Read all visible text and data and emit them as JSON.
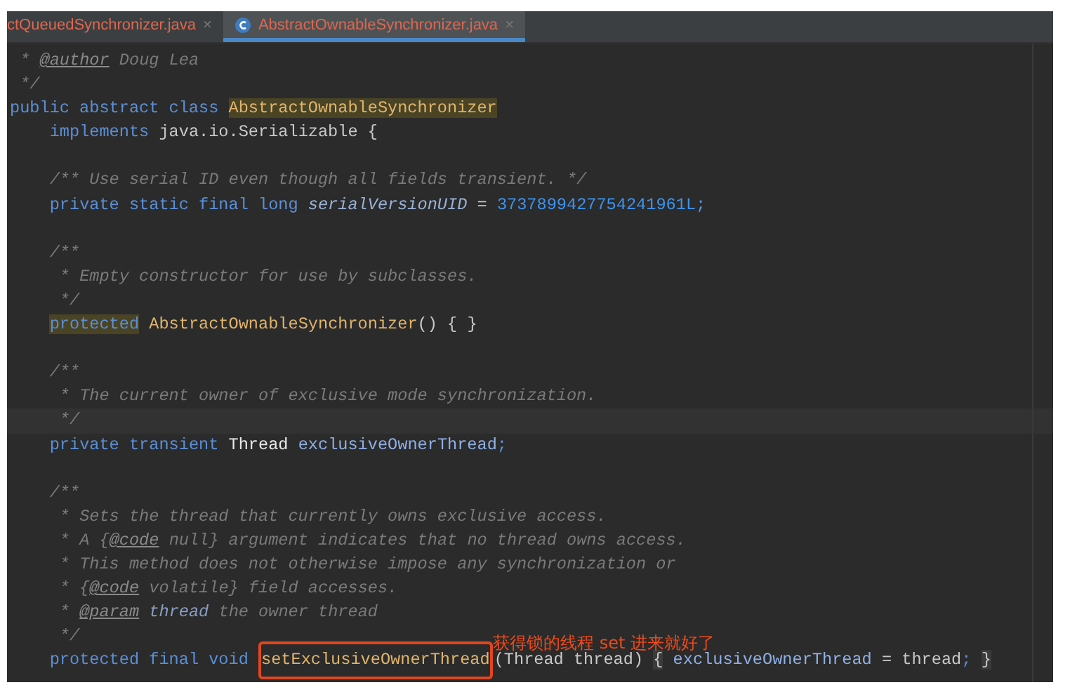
{
  "tabs": [
    {
      "label": "ctQueuedSynchronizer.java",
      "close": "×",
      "selected": false,
      "kind": "plain"
    },
    {
      "label": "AbstractOwnableSynchronizer.java",
      "close": "×",
      "selected": true,
      "kind": "class"
    }
  ],
  "code_lines": [
    {
      "kind": "code",
      "tokens": [
        {
          "kind": "comment",
          "text": " * "
        },
        {
          "kind": "tag",
          "text": "@author"
        },
        {
          "kind": "comment",
          "text": " Doug Lea"
        }
      ]
    },
    {
      "kind": "code",
      "tokens": [
        {
          "kind": "comment",
          "text": " */"
        }
      ]
    },
    {
      "kind": "code",
      "tokens": [
        {
          "kind": "kw",
          "text": "public abstract class "
        },
        {
          "kind": "decl-marked",
          "text": "AbstractOwnableSynchronizer"
        }
      ]
    },
    {
      "kind": "code",
      "tokens": [
        {
          "kind": "kw",
          "text": "    implements "
        },
        {
          "kind": "plain",
          "text": "java.io.Serializable {"
        }
      ]
    },
    {
      "kind": "blank"
    },
    {
      "kind": "code",
      "tokens": [
        {
          "kind": "comment",
          "text": "    /** Use serial ID even though all fields transient. */"
        }
      ]
    },
    {
      "kind": "code",
      "tokens": [
        {
          "kind": "kw",
          "text": "    private static final long "
        },
        {
          "kind": "static",
          "text": "serialVersionUID"
        },
        {
          "kind": "plain",
          "text": " = "
        },
        {
          "kind": "number",
          "text": "3737899427754241961L"
        },
        {
          "kind": "kw",
          "text": ";"
        }
      ]
    },
    {
      "kind": "blank"
    },
    {
      "kind": "code",
      "tokens": [
        {
          "kind": "comment",
          "text": "    /**"
        }
      ]
    },
    {
      "kind": "code",
      "tokens": [
        {
          "kind": "comment",
          "text": "     * Empty constructor for use by subclasses."
        }
      ]
    },
    {
      "kind": "code",
      "tokens": [
        {
          "kind": "comment",
          "text": "     */"
        }
      ]
    },
    {
      "kind": "code",
      "tokens": [
        {
          "kind": "kw-marked",
          "text": "    protected"
        },
        {
          "kind": "decl",
          "text": " AbstractOwnableSynchronizer"
        },
        {
          "kind": "plain",
          "text": "() { }"
        }
      ]
    },
    {
      "kind": "blank"
    },
    {
      "kind": "code",
      "tokens": [
        {
          "kind": "comment",
          "text": "    /**"
        }
      ]
    },
    {
      "kind": "code",
      "tokens": [
        {
          "kind": "comment",
          "text": "     * The current owner of exclusive mode synchronization."
        }
      ]
    },
    {
      "kind": "current",
      "tokens": [
        {
          "kind": "comment",
          "text": "     */"
        }
      ]
    },
    {
      "kind": "code",
      "tokens": [
        {
          "kind": "kw",
          "text": "    private transient "
        },
        {
          "kind": "type",
          "text": "Thread "
        },
        {
          "kind": "field",
          "text": "exclusiveOwnerThread"
        },
        {
          "kind": "kw",
          "text": ";"
        }
      ]
    },
    {
      "kind": "blank"
    },
    {
      "kind": "code",
      "tokens": [
        {
          "kind": "comment",
          "text": "    /**"
        }
      ]
    },
    {
      "kind": "code",
      "tokens": [
        {
          "kind": "comment",
          "text": "     * Sets the thread that currently owns exclusive access."
        }
      ]
    },
    {
      "kind": "code",
      "tokens": [
        {
          "kind": "comment",
          "text": "     * A {"
        },
        {
          "kind": "tag",
          "text": "@code"
        },
        {
          "kind": "comment",
          "text": " null} argument indicates that no thread owns access."
        }
      ]
    },
    {
      "kind": "code",
      "tokens": [
        {
          "kind": "comment",
          "text": "     * This method does not otherwise impose any synchronization or"
        }
      ]
    },
    {
      "kind": "code",
      "tokens": [
        {
          "kind": "comment",
          "text": "     * {"
        },
        {
          "kind": "tag",
          "text": "@code"
        },
        {
          "kind": "comment",
          "text": " volatile} field accesses."
        }
      ]
    },
    {
      "kind": "code",
      "tokens": [
        {
          "kind": "comment",
          "text": "     * "
        },
        {
          "kind": "tag",
          "text": "@param"
        },
        {
          "kind": "param",
          "text": " thread"
        },
        {
          "kind": "comment",
          "text": " the owner thread"
        }
      ]
    },
    {
      "kind": "code",
      "tokens": [
        {
          "kind": "comment",
          "text": "     */"
        }
      ]
    },
    {
      "kind": "code",
      "tokens": [
        {
          "kind": "kw",
          "text": "    protected final void "
        },
        {
          "kind": "decl-boxed",
          "text": "setExclusiveOwnerThread"
        },
        {
          "kind": "plain",
          "text": "(Thread thread) "
        },
        {
          "kind": "fold",
          "text": "{"
        },
        {
          "kind": "field",
          "text": " exclusiveOwnerThread"
        },
        {
          "kind": "plain",
          "text": " = thread"
        },
        {
          "kind": "kw",
          "text": ";"
        },
        {
          "kind": "fold",
          "text": " }"
        }
      ]
    }
  ],
  "annotation": {
    "text": "获得锁的线程 set 进来就好了"
  }
}
